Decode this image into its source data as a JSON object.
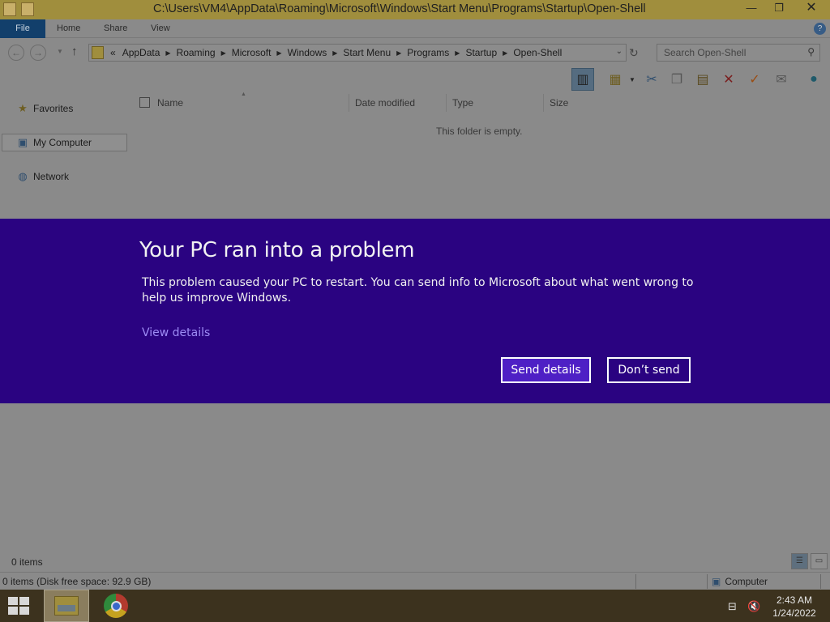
{
  "window": {
    "title": "C:\\Users\\VM4\\AppData\\Roaming\\Microsoft\\Windows\\Start Menu\\Programs\\Startup\\Open-Shell",
    "controls": {
      "minimize": "—",
      "restore": "❐",
      "close": "✕"
    }
  },
  "ribbon": {
    "tabs": [
      {
        "label": "File"
      },
      {
        "label": "Home"
      },
      {
        "label": "Share"
      },
      {
        "label": "View"
      }
    ],
    "help": "?"
  },
  "address": {
    "prefix": "«",
    "crumbs": [
      "AppData",
      "Roaming",
      "Microsoft",
      "Windows",
      "Start Menu",
      "Programs",
      "Startup",
      "Open-Shell"
    ],
    "sep": "▶",
    "drop": "⌄"
  },
  "search": {
    "placeholder": "Search Open-Shell"
  },
  "nav": {
    "favorites": "Favorites",
    "my_computer": "My Computer",
    "network": "Network"
  },
  "columns": {
    "name": "Name",
    "date_modified": "Date modified",
    "type": "Type",
    "size": "Size"
  },
  "content": {
    "empty_message": "This folder is empty."
  },
  "status": {
    "items": "0 items",
    "bar_left": "0 items (Disk free space: 92.9 GB)",
    "bar_right": "Computer"
  },
  "error_dialog": {
    "title": "Your PC ran into a problem",
    "body": "This problem caused your PC to restart. You can send info to Microsoft about what went wrong to help us improve Windows.",
    "view_details": "View details",
    "send_button": "Send details",
    "dont_send_button": "Don’t send"
  },
  "taskbar": {
    "time": "2:43 AM",
    "date": "1/24/2022"
  },
  "colors": {
    "dialog_bg": "#2a0381",
    "send_button_bg": "#4e20c5",
    "link": "#9e8cf5",
    "title_bar": "#a08e3d",
    "taskbar": "#3c321e"
  }
}
